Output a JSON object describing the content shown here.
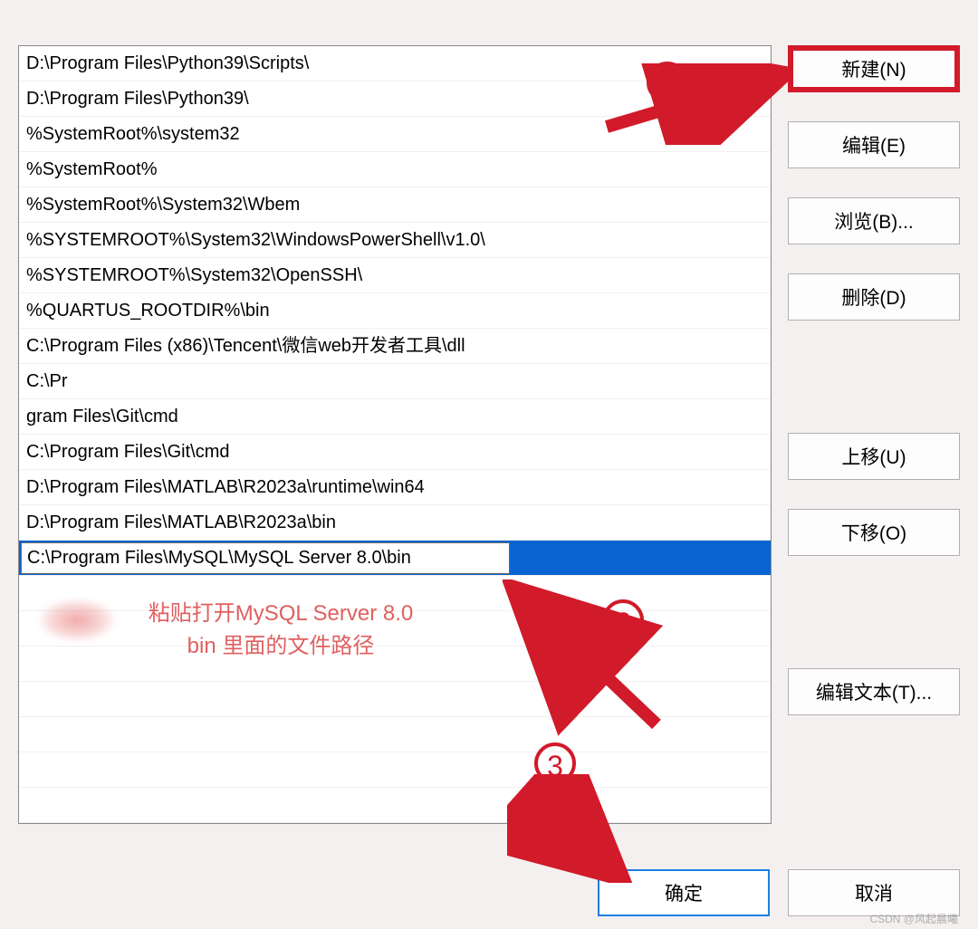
{
  "paths": [
    "D:\\Program Files\\Python39\\Scripts\\",
    "D:\\Program Files\\Python39\\",
    "%SystemRoot%\\system32",
    "%SystemRoot%",
    "%SystemRoot%\\System32\\Wbem",
    "%SYSTEMROOT%\\System32\\WindowsPowerShell\\v1.0\\",
    "%SYSTEMROOT%\\System32\\OpenSSH\\",
    "%QUARTUS_ROOTDIR%\\bin",
    "C:\\Program Files (x86)\\Tencent\\微信web开发者工具\\dll",
    "C:\\Pr",
    "gram Files\\Git\\cmd",
    "C:\\Program Files\\Git\\cmd",
    "D:\\Program Files\\MATLAB\\R2023a\\runtime\\win64",
    "D:\\Program Files\\MATLAB\\R2023a\\bin"
  ],
  "editing_value": "C:\\Program Files\\MySQL\\MySQL Server 8.0\\bin",
  "buttons": {
    "new": "新建(N)",
    "edit": "编辑(E)",
    "browse": "浏览(B)...",
    "delete": "删除(D)",
    "move_up": "上移(U)",
    "move_down": "下移(O)",
    "edit_text": "编辑文本(T)...",
    "ok": "确定",
    "cancel": "取消"
  },
  "annotations": {
    "step1": "1",
    "step2": "2",
    "step3": "3",
    "hint_line1": "粘贴打开MySQL Server 8.0",
    "hint_line2": "bin 里面的文件路径"
  },
  "watermark": "CSDN @风起晨曦"
}
